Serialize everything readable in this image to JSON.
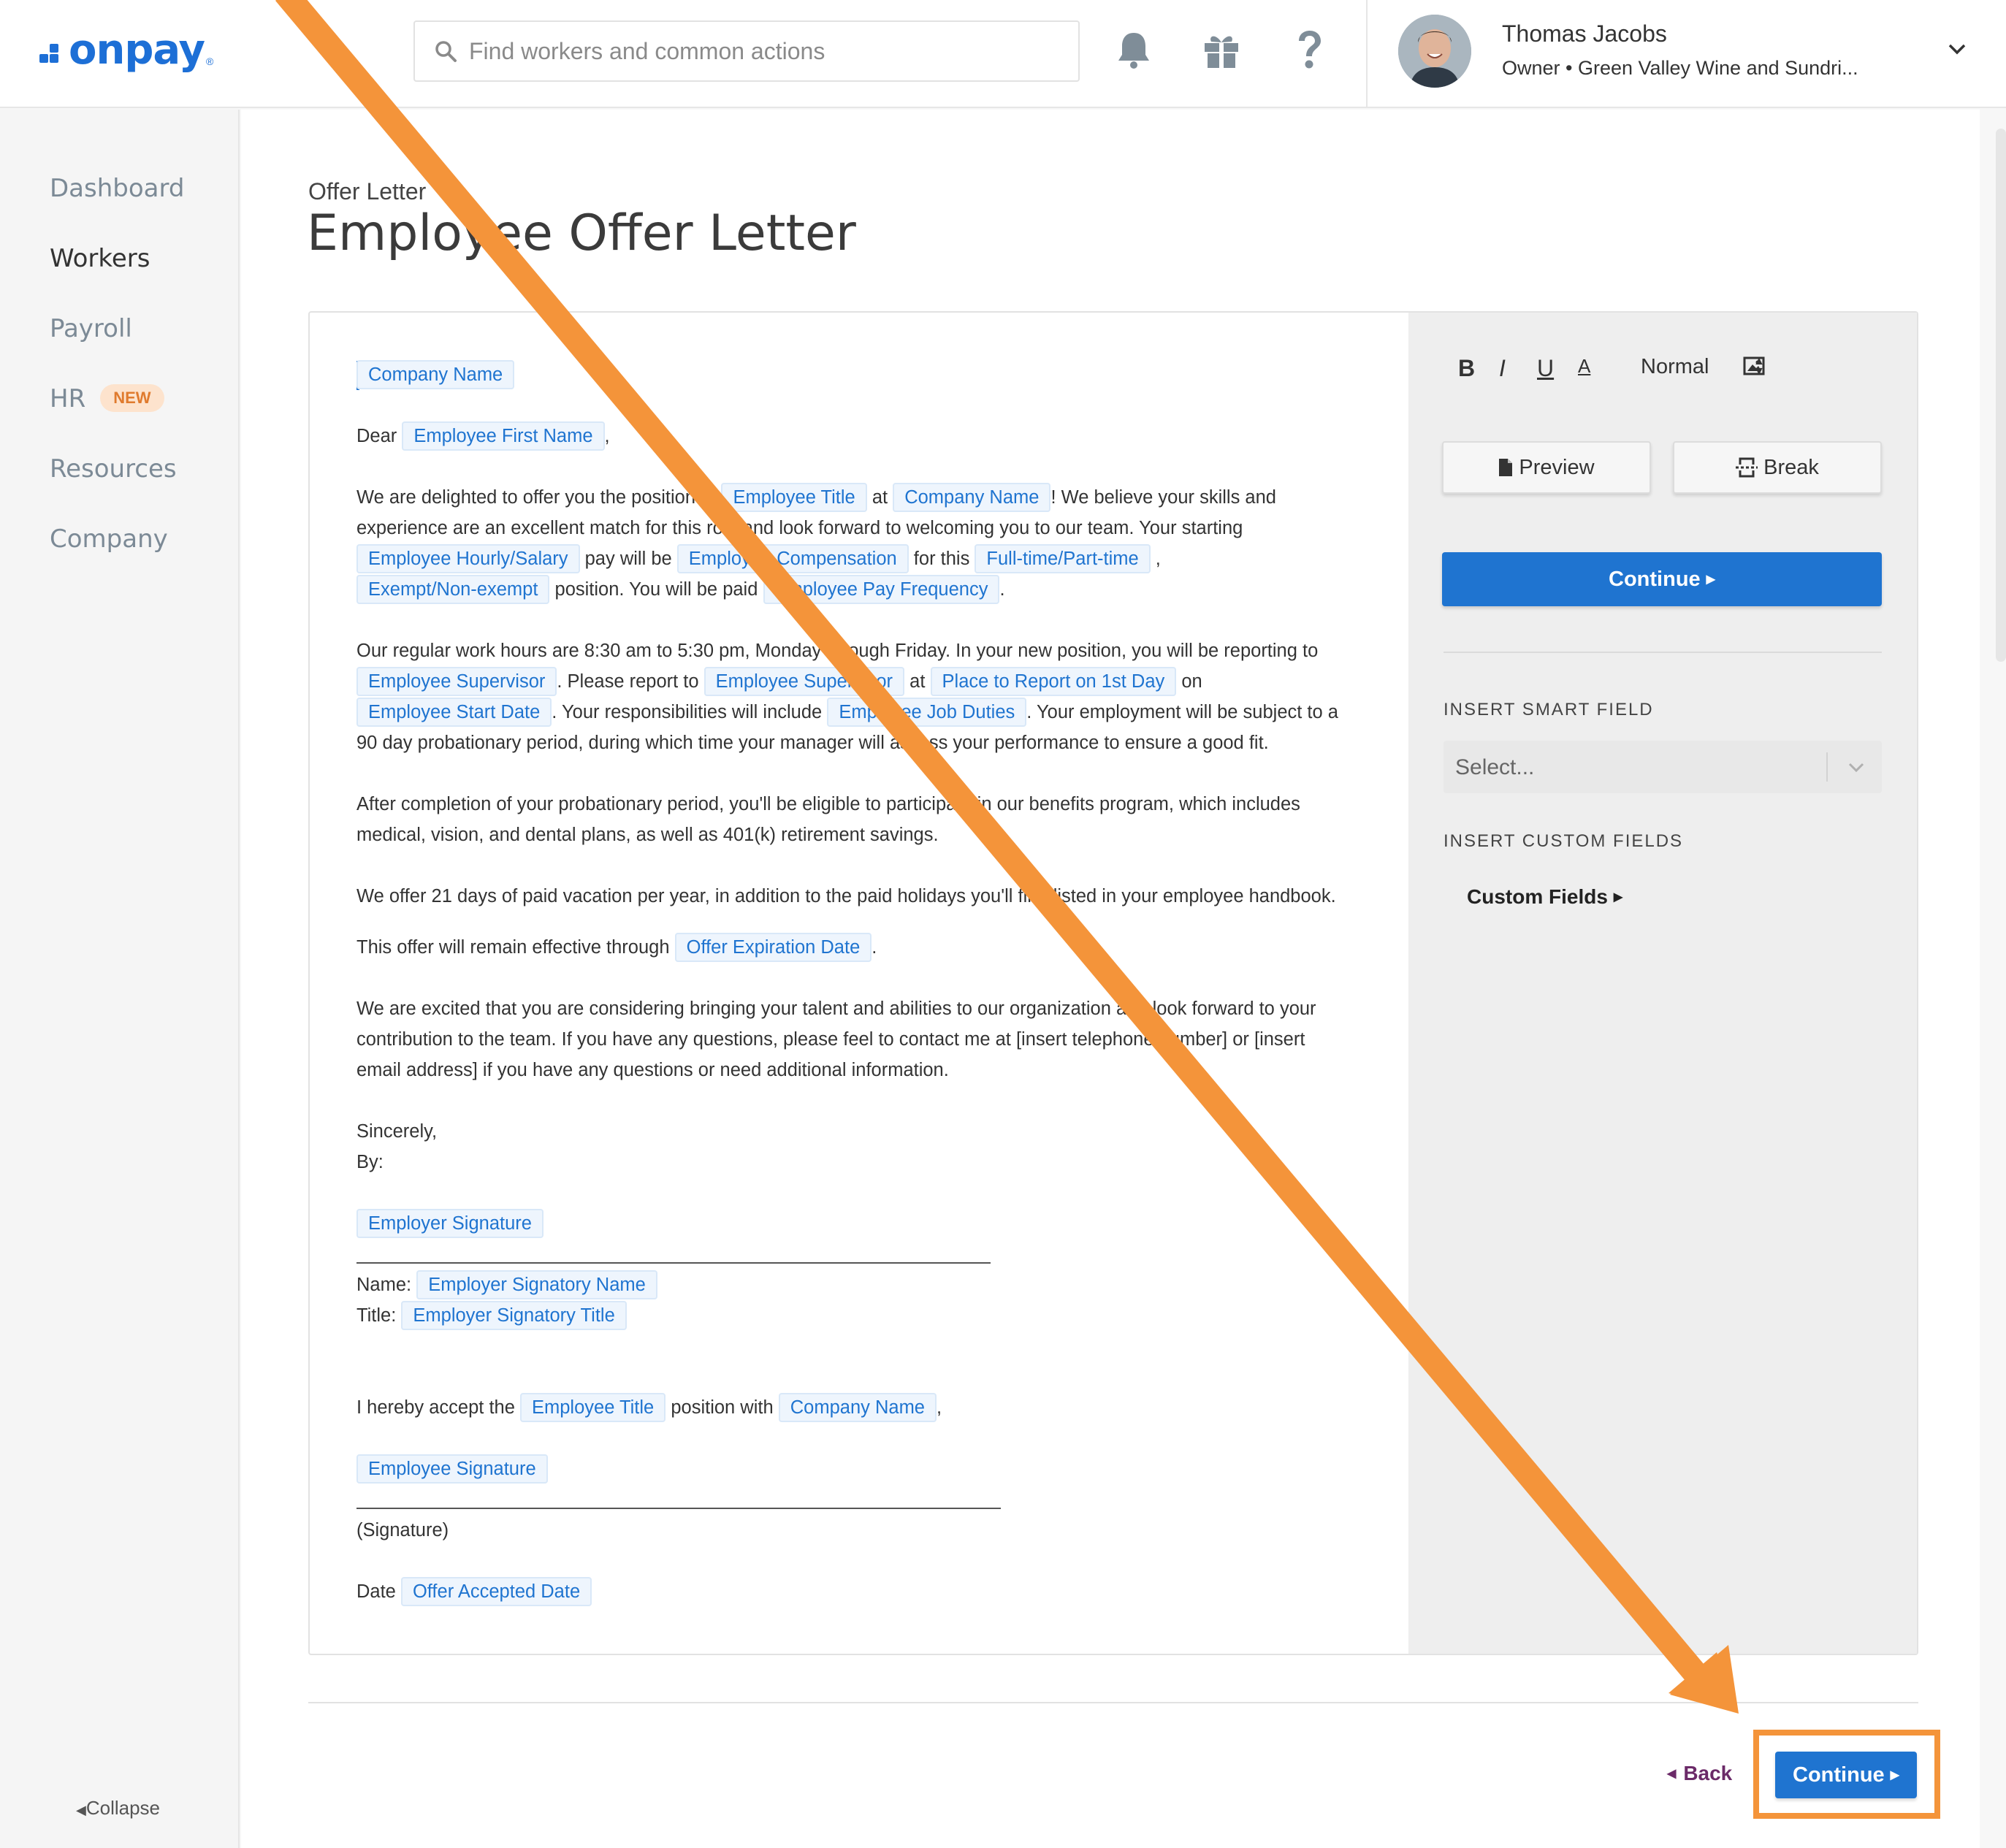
{
  "header": {
    "logo_text": "onpay",
    "logo_reg": "®",
    "search_placeholder": "Find workers and common actions",
    "icons": [
      "bell-icon",
      "gift-icon",
      "help-icon"
    ],
    "user_name": "Thomas Jacobs",
    "user_subtitle": "Owner • Green Valley Wine and Sundri..."
  },
  "sidebar": {
    "items": [
      {
        "label": "Dashboard"
      },
      {
        "label": "Workers"
      },
      {
        "label": "Payroll"
      },
      {
        "label": "HR",
        "badge": "NEW"
      },
      {
        "label": "Resources"
      },
      {
        "label": "Company"
      }
    ],
    "active": "Workers",
    "collapse_label": "Collapse"
  },
  "page": {
    "subtitle": "Offer Letter",
    "title": "Employee Offer Letter"
  },
  "letter": {
    "fields": {
      "company_name": "Company Name",
      "employee_first_name": "Employee First Name",
      "employee_title": "Employee Title",
      "hourly_salary": "Employee Hourly/Salary",
      "compensation": "Employee Compensation",
      "full_part_time": "Full-time/Part-time",
      "exempt": "Exempt/Non-exempt",
      "pay_frequency": "Employee Pay Frequency",
      "supervisor": "Employee Supervisor",
      "place_report": "Place to Report on 1st Day",
      "start_date": "Employee Start Date",
      "job_duties": "Employee Job Duties",
      "offer_expiration": "Offer Expiration Date",
      "employer_signature": "Employer Signature",
      "employer_signatory_name": "Employer Signatory Name",
      "employer_signatory_title": "Employer Signatory Title",
      "employee_signature": "Employee Signature",
      "offer_accepted_date": "Offer Accepted Date"
    },
    "t": {
      "dear": "Dear",
      "comma": ",",
      "p1a": "We are delighted to offer you the position of",
      "at": "at",
      "p1b": "! We believe your skills and",
      "p1c": "experience are an excellent match for this role and look forward to welcoming you to our team. Your starting",
      "pay_will_be": "pay will be",
      "for_this": "for this",
      "p1d": "position. You will be paid",
      "period": ".",
      "p2a": "Our regular work hours are 8:30 am to 5:30 pm, Monday through Friday. In your new position, you will be reporting to",
      "please_report": ". Please report to",
      "on": "on",
      "resp": ". Your responsibilities will include",
      "subject": ". Your employment will be subject to a",
      "p2b": "90 day probationary period, during which time your manager will assess your performance to ensure a good fit.",
      "p3a": "After completion of your probationary period, you'll be eligible to participate in our benefits program, which includes",
      "p3b": "medical, vision, and dental plans, as well as 401(k) retirement savings.",
      "p4": "We offer 21 days of paid vacation per year, in addition to the paid holidays you'll find listed in your employee handbook.",
      "p5": "This offer will remain effective through",
      "p6a": "We are excited that you are considering bringing your talent and abilities to our organization and look forward to your",
      "p6b": "contribution to the team. If you have any questions, please feel to contact me at [insert telephone number] or [insert",
      "p6c": "email address] if you have any questions or need additional information.",
      "sincerely": "Sincerely,",
      "by": "By:",
      "name": "Name:",
      "title": "Title:",
      "accept": "I hereby accept the",
      "position_with": "position with",
      "signature": "(Signature)",
      "date": "Date"
    }
  },
  "panel": {
    "format_select": "Normal",
    "preview_label": "Preview",
    "break_label": "Break",
    "continue_label": "Continue",
    "smart_field_label": "INSERT SMART FIELD",
    "smart_field_placeholder": "Select...",
    "custom_fields_label": "INSERT CUSTOM FIELDS",
    "custom_fields_link": "Custom Fields"
  },
  "footer": {
    "back_label": "Back",
    "continue_label": "Continue"
  },
  "colors": {
    "brand": "#1d6fd6",
    "primary_button": "#1f74d0",
    "annotation": "#f4943a",
    "back_link": "#6b2a68"
  }
}
